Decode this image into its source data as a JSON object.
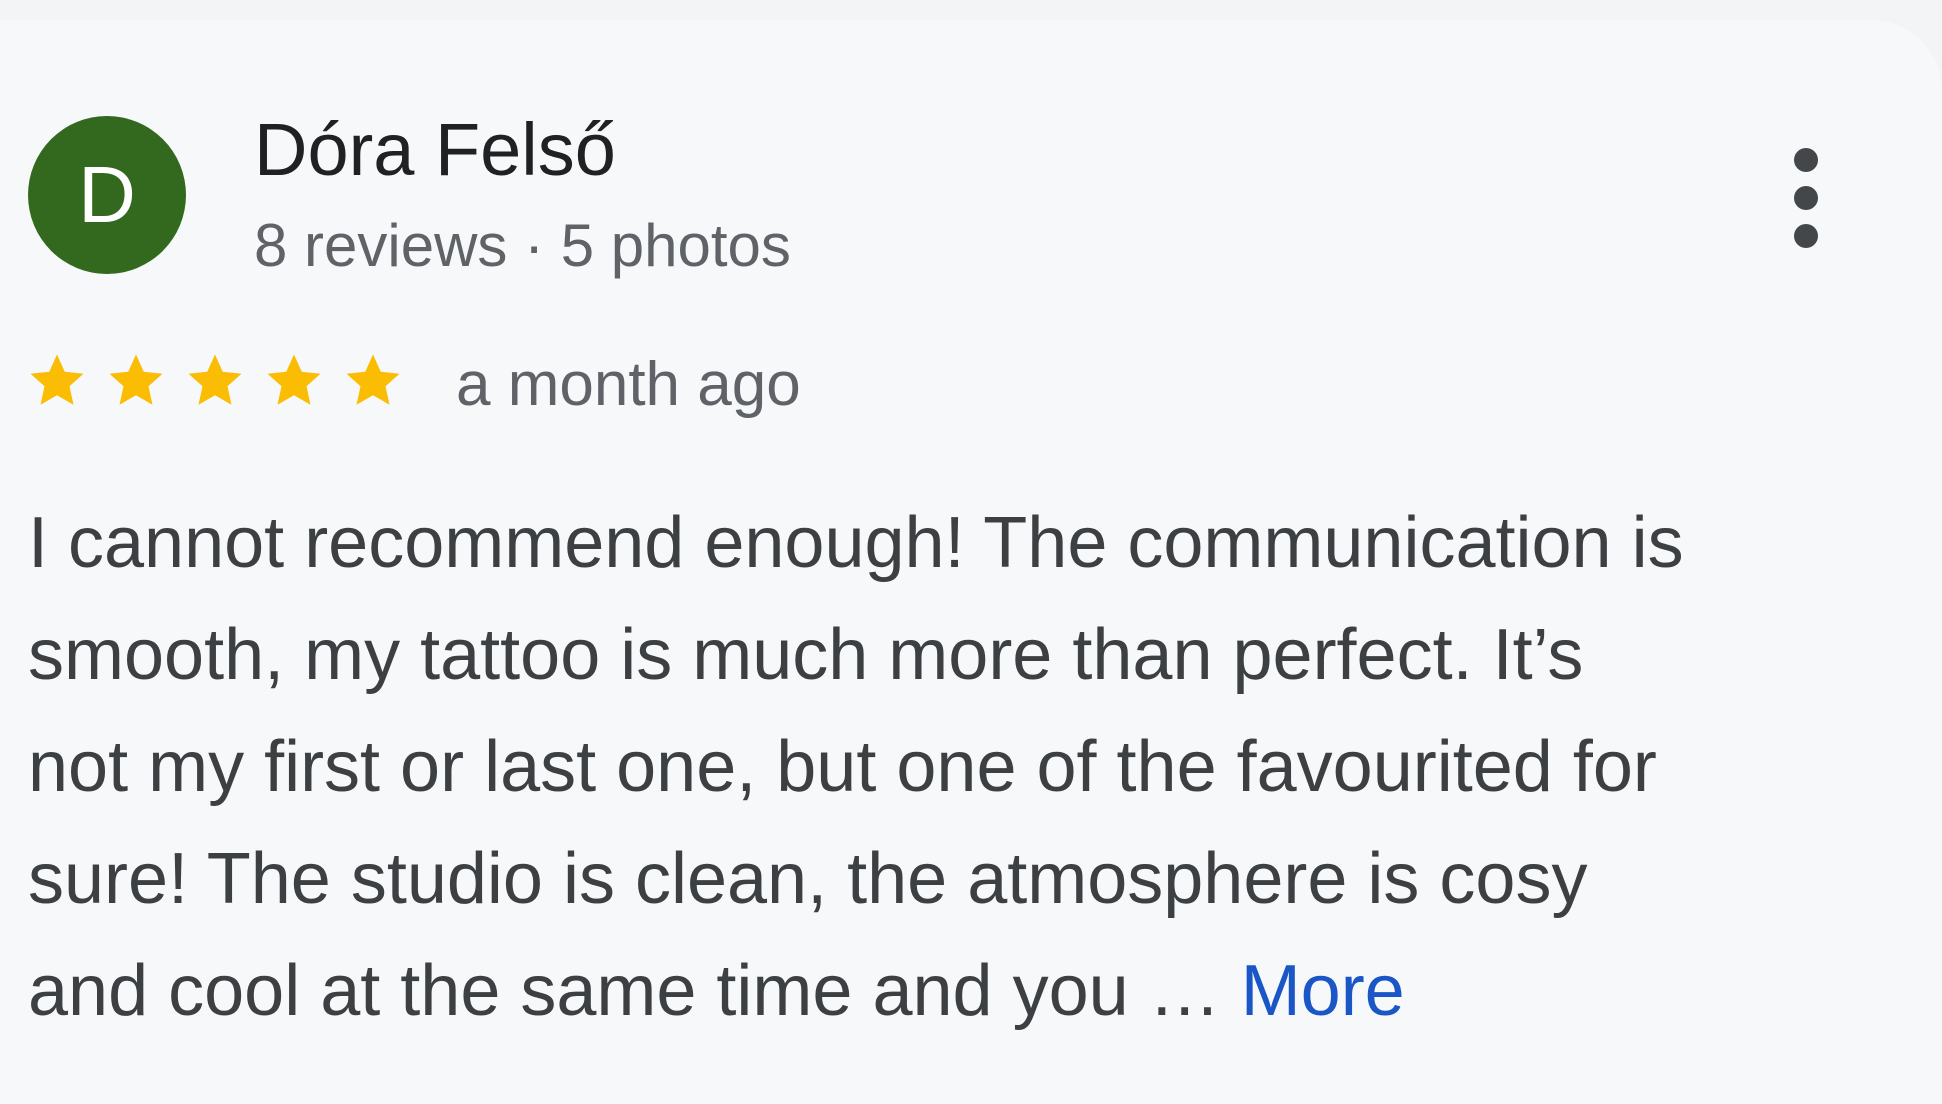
{
  "reviewer": {
    "avatar_letter": "D",
    "avatar_color": "#33691e",
    "name": "Dóra Felső",
    "stats": "8 reviews · 5 photos"
  },
  "menu": {
    "icon": "more-vert-icon"
  },
  "rating": {
    "stars": 5,
    "max_stars": 5,
    "star_color": "#fbbc04",
    "time_ago": "a month ago"
  },
  "review": {
    "lines": [
      "I cannot recommend enough! The communication is",
      "smooth, my tattoo is much more than perfect. It’s",
      "not my first or last one, but one of the favourited for",
      "sure! The studio is clean, the atmosphere is cosy",
      "and cool at the same time and you … "
    ],
    "more_label": "More",
    "more_color": "#1a56c6"
  }
}
